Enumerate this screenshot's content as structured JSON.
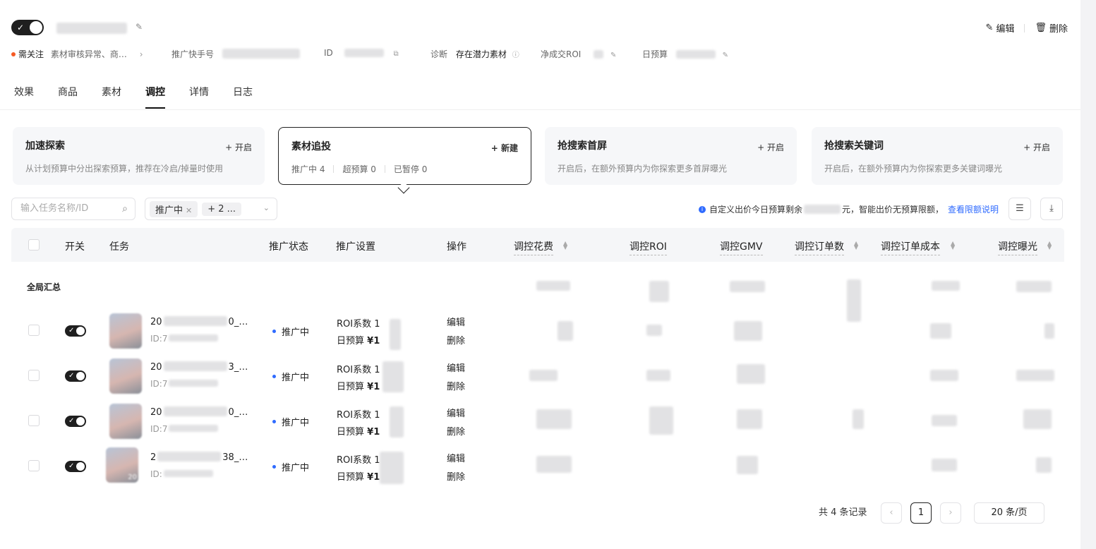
{
  "header": {
    "toggle_check": "✓",
    "edit_label": "编辑",
    "delete_label": "删除"
  },
  "meta": {
    "status_label": "需关注",
    "status_detail": "素材审核异常、商…",
    "account_label": "推广快手号",
    "id_label": "ID",
    "diagnosis_label": "诊断",
    "diagnosis_value": "存在潜力素材",
    "roi_label": "净成交ROI",
    "budget_label": "日预算"
  },
  "tabs": [
    {
      "label": "效果"
    },
    {
      "label": "商品"
    },
    {
      "label": "素材"
    },
    {
      "label": "调控"
    },
    {
      "label": "详情"
    },
    {
      "label": "日志"
    }
  ],
  "cards": [
    {
      "title": "加速探索",
      "action": "+ 开启",
      "desc": "从计划预算中分出探索预算，推荐在冷启/掉量时使用"
    },
    {
      "title": "素材追投",
      "action": "+ 新建",
      "stat1": "推广中 4",
      "stat2": "超预算 0",
      "stat3": "已暂停 0"
    },
    {
      "title": "抢搜索首屏",
      "action": "+ 开启",
      "desc": "开启后，在额外预算内为你探索更多首屏曝光"
    },
    {
      "title": "抢搜索关键词",
      "action": "+ 开启",
      "desc": "开启后，在额外预算内为你探索更多关键词曝光"
    }
  ],
  "filters": {
    "search_placeholder": "输入任务名称/ID",
    "chip_label": "推广中",
    "chip_more": "+ 2 ...",
    "budget_prefix": "自定义出价今日预算剩余",
    "budget_suffix": "元，智能出价无预算限额，",
    "budget_link": "查看限额说明"
  },
  "table": {
    "headers": {
      "switch": "开关",
      "task": "任务",
      "status": "推广状态",
      "setting": "推广设置",
      "op": "操作",
      "cost": "调控花费",
      "roi": "调控ROI",
      "gmv": "调控GMV",
      "orders": "调控订单数",
      "order_cost": "调控订单成本",
      "exposure": "调控曝光"
    },
    "summary_label": "全局汇总",
    "rows": [
      {
        "name": "20",
        "name_tail": "0_…",
        "id": "ID:7",
        "status": "推广中",
        "roi_label": "ROI系数",
        "roi_val": "1",
        "budget_label": "日预算",
        "budget_val": "¥1",
        "edit": "编辑",
        "delete": "删除",
        "thumb_badge": ""
      },
      {
        "name": "20",
        "name_tail": "3_…",
        "id": "ID:7",
        "status": "推广中",
        "roi_label": "ROI系数",
        "roi_val": "1",
        "budget_label": "日预算",
        "budget_val": "¥1",
        "edit": "编辑",
        "delete": "删除",
        "thumb_badge": ""
      },
      {
        "name": "20",
        "name_tail": "0_…",
        "id": "ID:7",
        "status": "推广中",
        "roi_label": "ROI系数",
        "roi_val": "1",
        "budget_label": "日预算",
        "budget_val": "¥1",
        "edit": "编辑",
        "delete": "删除",
        "thumb_badge": ""
      },
      {
        "name": "2",
        "name_tail": "38_…",
        "id": "ID:",
        "status": "推广中",
        "roi_label": "ROI系数",
        "roi_val": "1",
        "budget_label": "日预算",
        "budget_val": "¥1",
        "edit": "编辑",
        "delete": "删除",
        "thumb_badge": "20"
      }
    ]
  },
  "pager": {
    "total": "共 4 条记录",
    "prev": "‹",
    "current": "1",
    "next": "›",
    "page_size": "20 条/页"
  }
}
